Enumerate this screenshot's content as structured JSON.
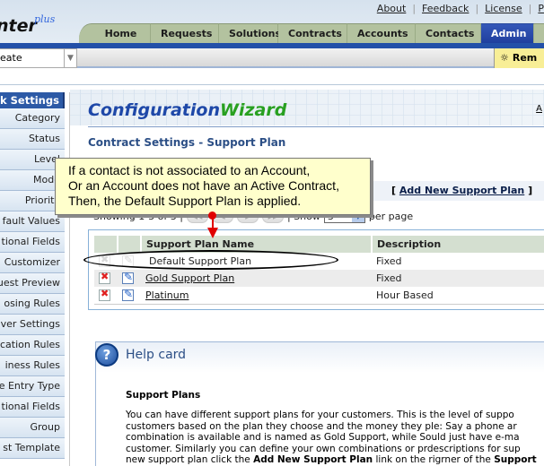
{
  "header": {
    "logo_text": "nter",
    "logo_suffix": "plus",
    "top_links": [
      "About",
      "Feedback",
      "License",
      "P"
    ],
    "tabs": [
      {
        "label": "Home",
        "active": false
      },
      {
        "label": "Requests",
        "active": false
      },
      {
        "label": "Solutions",
        "active": false
      },
      {
        "label": "Contracts",
        "active": false
      },
      {
        "label": "Accounts",
        "active": false
      },
      {
        "label": "Contacts",
        "active": false
      },
      {
        "label": "Admin",
        "active": true
      },
      {
        "label": "",
        "active": false
      }
    ]
  },
  "toolbar": {
    "quick_create_value": "eate",
    "reminder_label": "Rem"
  },
  "sidebar": {
    "heading": "k Settings",
    "items": [
      "Category",
      "Status",
      "Level",
      "Mode",
      "Priority",
      "fault Values",
      "tional Fields",
      "Customizer",
      "uest Preview",
      "osing Rules",
      "ver Settings",
      "cation Rules",
      "iness Rules",
      "e Entry Type",
      "tional Fields",
      "Group",
      "st Template"
    ]
  },
  "wizard": {
    "title_part1": "Configuration",
    "title_part2": "Wizard",
    "corner_link": "A"
  },
  "page": {
    "title": "Contract Settings - Support Plan",
    "add_link": "Add New Support Plan",
    "pager": {
      "showing": "Showing 1-3 of 3 |",
      "show_label": "| Show",
      "per_page_value": "3",
      "per_page_label": "per page"
    },
    "table": {
      "columns": [
        "",
        "",
        "Support Plan Name",
        "Description"
      ],
      "rows": [
        {
          "name": "Default Support Plan",
          "description": "Fixed",
          "editable": false
        },
        {
          "name": "Gold Support Plan",
          "description": "Fixed",
          "editable": true
        },
        {
          "name": "Platinum",
          "description": "Hour Based",
          "editable": true
        }
      ]
    }
  },
  "callout": {
    "lines": [
      "If a contact is not associated to an Account,",
      "Or an Account does not have an Active Contract,",
      "Then, the Default Support Plan is applied."
    ]
  },
  "help_card": {
    "title": "Help card",
    "subtitle": "Support Plans",
    "lines": [
      "You can have different support plans for your customers. This is the level of suppo",
      "customers based on the plan they choose and the money they ple: Say a phone ar",
      "combination is available and is named as Gold Support, while Sould just have e-ma",
      "customer. Similarly you can define your own combinations or prdescriptions for sup"
    ],
    "last_line_pre": "new support plan click the ",
    "last_line_bold1": "Add New Support Plan",
    "last_line_mid": " link on the rigrner of the ",
    "last_line_bold2": "Support"
  }
}
